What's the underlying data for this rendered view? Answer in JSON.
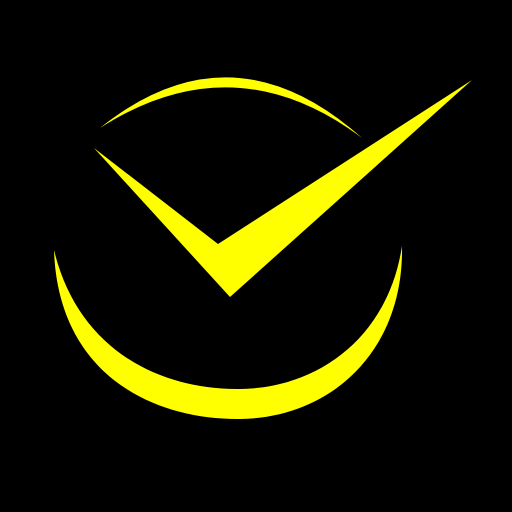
{
  "logo": {
    "icon": "check-circle-icon",
    "background_color": "#000000",
    "accent_color": "#FFFF00"
  }
}
